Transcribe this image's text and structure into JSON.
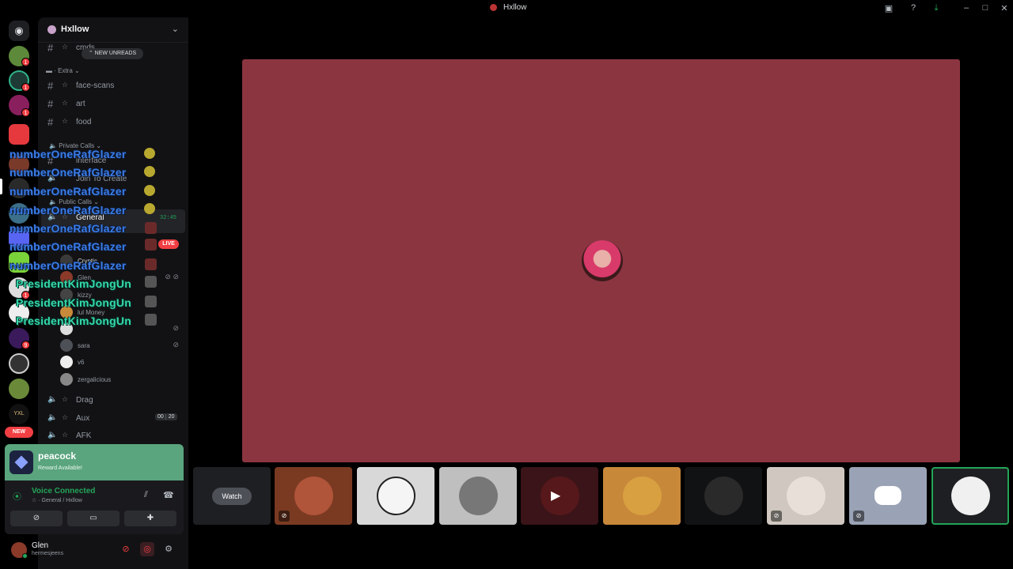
{
  "window": {
    "title": "Hxllow"
  },
  "server": {
    "name": "Hxllow"
  },
  "unread_pill": "NEW UNREADS",
  "channels": {
    "top_cmds": "cmds",
    "extra_category": "Extra",
    "face_scans": "face-scans",
    "art": "art",
    "food": "food",
    "private_category": "Private Calls",
    "interface": "interface",
    "join_to_create": "Join To Create",
    "public_category": "Public Calls",
    "general": "General",
    "general_timer": "32:45",
    "live": "LIVE",
    "drag": "Drag",
    "aux": "Aux",
    "aux_count_a": "00",
    "aux_count_b": "20",
    "afk": "AFK"
  },
  "members": [
    "Cryptic",
    "Glen",
    "kizzy",
    "lul Money",
    "sara",
    "v6",
    "zergalicious"
  ],
  "overlay": {
    "blue_name": "numberOneRafGlazer",
    "green_name": "PresidentKimJongUn"
  },
  "rail": {
    "new_label": "NEW"
  },
  "promo": {
    "name": "peacock",
    "subtitle": "Reward Available!"
  },
  "voice": {
    "status": "Voice Connected",
    "location": "General / Hxllow"
  },
  "user": {
    "name": "Glen",
    "handle": "hermesjeens"
  },
  "stage": {
    "watch_label": "Watch"
  },
  "colors": {
    "stage_bg": "#8b3541",
    "sidebar_bg": "#121214",
    "accent_green": "#23a559",
    "live_red": "#f23f43"
  }
}
